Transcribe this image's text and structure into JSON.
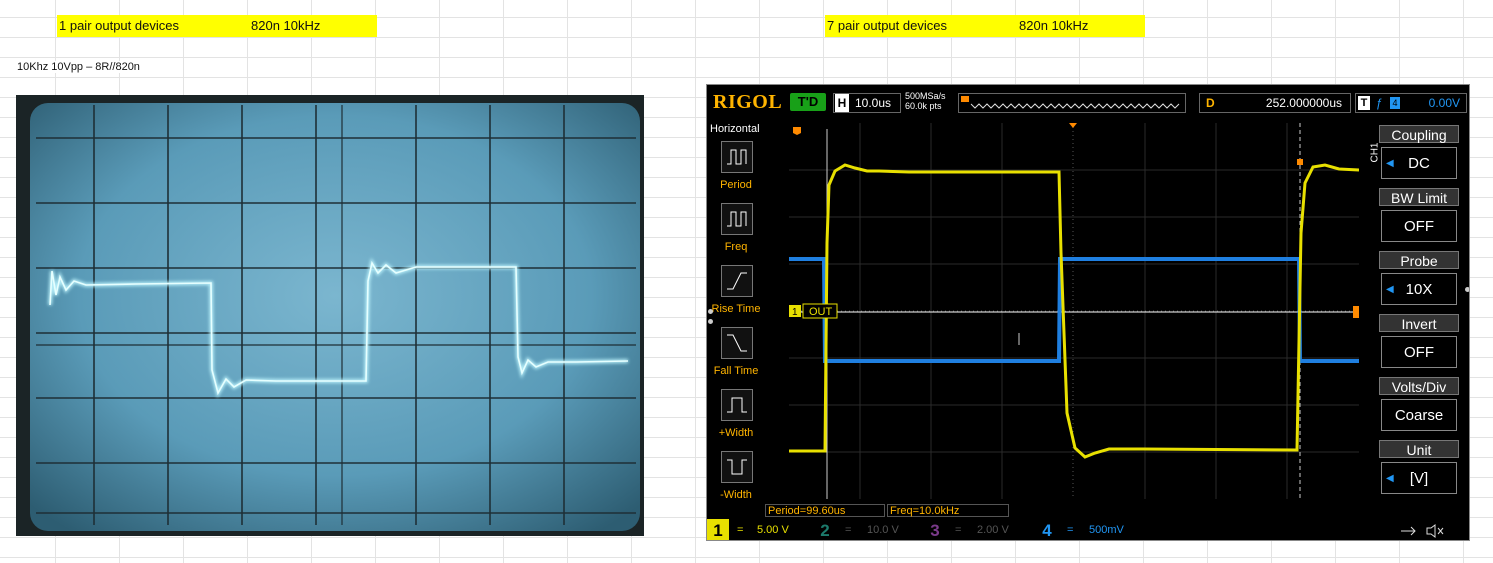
{
  "sheet": {
    "left_header": {
      "label": "1 pair output devices",
      "value": "820n 10kHz"
    },
    "right_header": {
      "label": "7 pair output devices",
      "value": "820n 10kHz"
    },
    "note": "10Khz 10Vpp – 8R//820n"
  },
  "colors": {
    "highlight": "#ffff00",
    "scope_trace_yellow": "#e8e000",
    "scope_trace_blue": "#1f7fe0",
    "analog_trace": "#bff6ff",
    "rigol_orange": "#ffb400"
  },
  "rigol": {
    "logo": "RIGOL",
    "trigger_state": "T'D",
    "horizontal": {
      "key": "H",
      "value": "10.0us"
    },
    "sample_rate": "500MSa/s",
    "memory_depth": "60.0k pts",
    "delay": {
      "key": "D",
      "value": "252.000000us"
    },
    "trigger": {
      "key": "T",
      "edge_icon": "rising-edge-icon",
      "source": "4",
      "level": "0.00V"
    },
    "left_menu": {
      "title": "Horizontal",
      "items": [
        {
          "label": "Period",
          "icon": "period-icon"
        },
        {
          "label": "Freq",
          "icon": "freq-icon"
        },
        {
          "label": "Rise Time",
          "icon": "rise-time-icon"
        },
        {
          "label": "Fall Time",
          "icon": "fall-time-icon"
        },
        {
          "label": "+Width",
          "icon": "plus-width-icon"
        },
        {
          "label": "-Width",
          "icon": "minus-width-icon"
        }
      ]
    },
    "channel_tag": "CH1",
    "right_menu": [
      {
        "label": "Coupling",
        "value": "DC"
      },
      {
        "label": "BW Limit",
        "value": "OFF"
      },
      {
        "label": "Probe",
        "value": "10X"
      },
      {
        "label": "Invert",
        "value": "OFF"
      },
      {
        "label": "Volts/Div",
        "value": "Coarse"
      },
      {
        "label": "Unit",
        "value": "[V]"
      }
    ],
    "out_label": "OUT",
    "ch1_marker": "1",
    "measurements": {
      "period": "Period=99.60us",
      "freq": "Freq=10.0kHz"
    },
    "channels": [
      {
        "num": "1",
        "coupling": "=",
        "scale": "5.00 V",
        "color": "#e8e000"
      },
      {
        "num": "2",
        "coupling": "=",
        "scale": "10.0 V",
        "color": "#1c7a6c"
      },
      {
        "num": "3",
        "coupling": "=",
        "scale": "2.00 V",
        "color": "#7a3a8a"
      },
      {
        "num": "4",
        "coupling": "=",
        "scale": "500mV",
        "color": "#2196f3"
      }
    ]
  }
}
